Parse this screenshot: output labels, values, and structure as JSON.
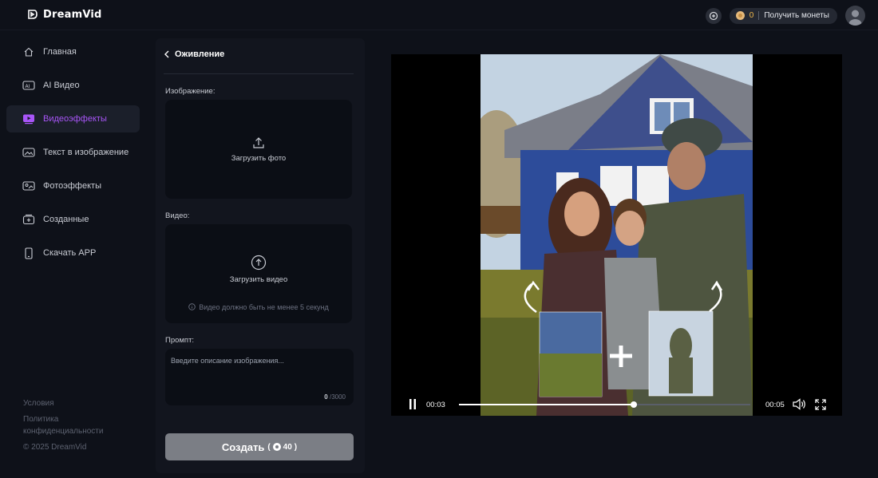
{
  "app": {
    "name": "DreamVid"
  },
  "header": {
    "coin_count": "0",
    "get_coins_label": "Получить монеты",
    "accent_color": "#f1b84b"
  },
  "sidebar": {
    "items": [
      {
        "label": "Главная",
        "icon": "home-icon",
        "active": false
      },
      {
        "label": "AI Видео",
        "icon": "ai-video-icon",
        "active": false
      },
      {
        "label": "Видеоэффекты",
        "icon": "video-effects-icon",
        "active": true
      },
      {
        "label": "Текст в изображение",
        "icon": "image-icon",
        "active": false
      },
      {
        "label": "Фотоэффекты",
        "icon": "photo-effects-icon",
        "active": false
      },
      {
        "label": "Созданные",
        "icon": "created-icon",
        "active": false
      },
      {
        "label": "Скачать APP",
        "icon": "phone-icon",
        "active": false
      }
    ],
    "active_color": "#a855f7",
    "footer": {
      "terms": "Условия",
      "privacy": "Политика конфиденциальности",
      "copyright": "© 2025 DreamVid"
    }
  },
  "panel": {
    "title": "Оживление",
    "image_label": "Изображение:",
    "upload_photo": "Загрузить фото",
    "video_label": "Видео:",
    "upload_video": "Загрузить видео",
    "video_hint": "Видео должно быть не менее 5 секунд",
    "prompt_label": "Промпт:",
    "prompt_placeholder": "Введите описание изображения...",
    "prompt_count": "0",
    "prompt_max": "/3000",
    "create_label": "Создать",
    "create_open": "(",
    "create_cost": "40",
    "create_close": ")"
  },
  "player": {
    "current_time": "00:03",
    "total_time": "00:05",
    "progress": 0.6
  }
}
